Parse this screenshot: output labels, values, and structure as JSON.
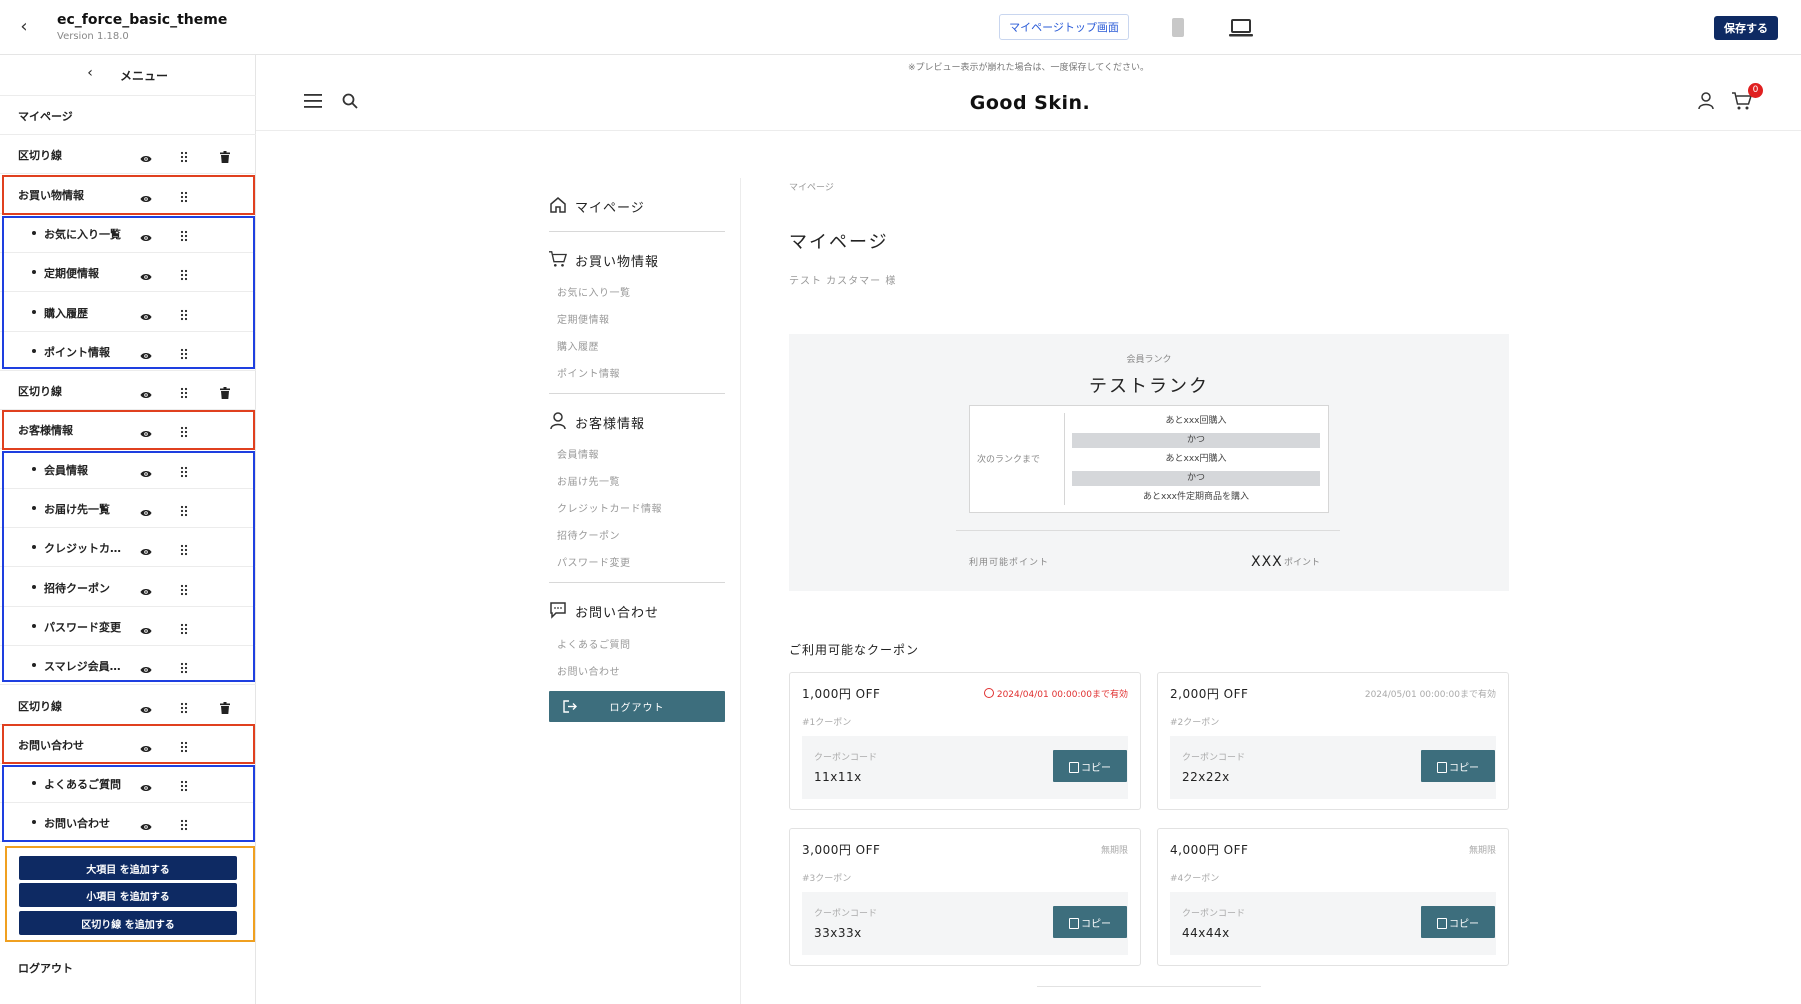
{
  "topbar": {
    "theme_name": "ec_force_basic_theme",
    "version": "Version 1.18.0",
    "preview_page": "マイページトップ画面",
    "save_label": "保存する"
  },
  "sidebar": {
    "header": "メニュー",
    "items": [
      {
        "label": "マイページ"
      },
      {
        "label": "区切り線"
      },
      {
        "label": "お買い物情報"
      },
      {
        "label": "お気に入り一覧"
      },
      {
        "label": "定期便情報"
      },
      {
        "label": "購入履歴"
      },
      {
        "label": "ポイント情報"
      },
      {
        "label": "区切り線"
      },
      {
        "label": "お客様情報"
      },
      {
        "label": "会員情報"
      },
      {
        "label": "お届け先一覧"
      },
      {
        "label": "クレジットカ…"
      },
      {
        "label": "招待クーポン"
      },
      {
        "label": "パスワード変更"
      },
      {
        "label": "スマレジ会員…"
      },
      {
        "label": "区切り線"
      },
      {
        "label": "お問い合わせ"
      },
      {
        "label": "よくあるご質問"
      },
      {
        "label": "お問い合わせ"
      }
    ],
    "add_large": "大項目 を追加する",
    "add_small": "小項目 を追加する",
    "add_divider": "区切り線 を追加する",
    "logout": "ログアウト"
  },
  "preview": {
    "notice": "※プレビュー表示が崩れた場合は、一度保存してください。",
    "brand": "Good Skin.",
    "cart_count": "0",
    "nav": {
      "mypage": "マイページ",
      "shopping": "お買い物情報",
      "shopping_items": [
        "お気に入り一覧",
        "定期便情報",
        "購入履歴",
        "ポイント情報"
      ],
      "customer": "お客様情報",
      "customer_items": [
        "会員情報",
        "お届け先一覧",
        "クレジットカード情報",
        "招待クーポン",
        "パスワード変更"
      ],
      "contact": "お問い合わせ",
      "contact_items": [
        "よくあるご質問",
        "お問い合わせ"
      ],
      "logout": "ログアウト"
    },
    "breadcrumb": "マイページ",
    "title": "マイページ",
    "customer_name": "テスト カスタマー 様",
    "rank": {
      "label": "会員ランク",
      "name": "テストランク",
      "next_label": "次のランクまで",
      "conditions": [
        "あとxxx回購入",
        "かつ",
        "あとxxx円購入",
        "かつ",
        "あとxxx件定期商品を購入"
      ],
      "points_label": "利用可能ポイント",
      "points_value": "XXX",
      "points_unit": "ポイント"
    },
    "coupons_heading": "ご利用可能なクーポン",
    "coupons": [
      {
        "price": "1,000円 OFF",
        "valid": "2024/04/01 00:00:00まで有効",
        "name": "#1クーポン",
        "code_label": "クーポンコード",
        "code": "11x11x",
        "copy": "コピー"
      },
      {
        "price": "2,000円 OFF",
        "valid": "2024/05/01 00:00:00まで有効",
        "name": "#2クーポン",
        "code_label": "クーポンコード",
        "code": "22x22x",
        "copy": "コピー"
      },
      {
        "price": "3,000円 OFF",
        "valid": "無期限",
        "name": "#3クーポン",
        "code_label": "クーポンコード",
        "code": "33x33x",
        "copy": "コピー"
      },
      {
        "price": "4,000円 OFF",
        "valid": "無期限",
        "name": "#4クーポン",
        "code_label": "クーポンコード",
        "code": "44x44x",
        "copy": "コピー"
      }
    ]
  },
  "colors": {
    "primary_navy": "#0e2a63",
    "teal_button": "#3d6e7d",
    "highlight_red": "#e0401f",
    "highlight_blue": "#1e3fe0",
    "highlight_orange": "#f0a020",
    "warning_red": "#e03030"
  }
}
